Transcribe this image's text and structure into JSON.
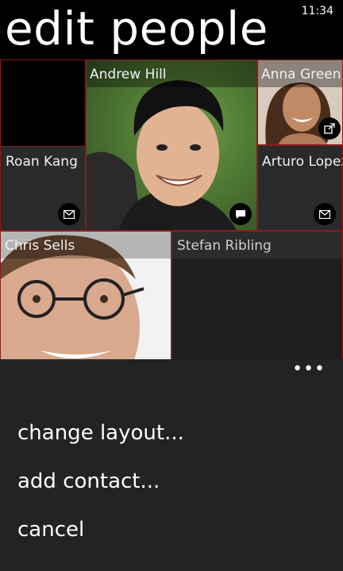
{
  "status_bar": {
    "time": "11:34"
  },
  "page": {
    "title": "edit people"
  },
  "tiles": {
    "roan": {
      "name": "Roan Kang",
      "badge_icon": "mail-icon"
    },
    "andrew": {
      "name": "Andrew Hill",
      "badge_icon": "message-icon"
    },
    "anna": {
      "name": "Anna Green",
      "badge_icon": "share-icon"
    },
    "arturo": {
      "name": "Arturo Lopez",
      "badge_icon": "mail-icon"
    },
    "chris": {
      "name": "Chris Sells"
    },
    "stefan": {
      "name": "Stefan Ribling"
    }
  },
  "app_bar": {
    "more_glyph": "•••",
    "items": [
      "change layout...",
      "add contact...",
      "cancel"
    ]
  },
  "colors": {
    "accent_border": "#8a1c1c",
    "tile_bg": "#2a2a2a",
    "menu_bg": "#232323"
  }
}
